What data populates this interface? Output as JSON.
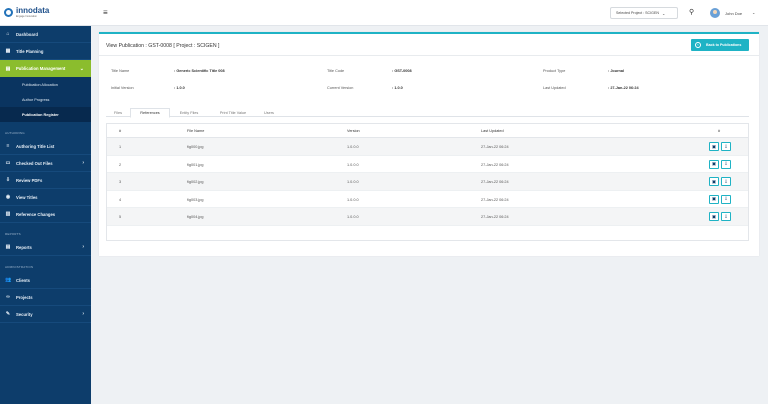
{
  "app": {
    "logo_name": "innodata",
    "logo_tagline": "Engage Innovation"
  },
  "sidebar": {
    "dashboard": "Dashboard",
    "title_planning": "Title Planning",
    "publication_management": "Publication Management",
    "sub_items": [
      "Publication Allocation",
      "Author Progress",
      "Publication Register"
    ],
    "section_authoring": "AUTHORING",
    "authoring_items": [
      "Authoring Title List",
      "Checked Out Files",
      "Review PDFs",
      "View Titles",
      "Reference Changes"
    ],
    "section_reports": "REPORTS",
    "reports": "Reports",
    "section_admin": "ADMINISTRATION",
    "admin_items": [
      "Clients",
      "Projects",
      "Security"
    ]
  },
  "topbar": {
    "project_selector": "Selected Project : SCIGEN",
    "user_name": "John Doe"
  },
  "page": {
    "title": "View Publication : GST-0008 [ Project : SCIGEN ]",
    "back_button": "Back to Publications",
    "meta": {
      "title_name_label": "Title Name",
      "title_name_value": ": Generic Scientific Title 008",
      "title_code_label": "Title Code",
      "title_code_value": ": GST-0008",
      "product_type_label": "Product Type",
      "product_type_value": ": Journal",
      "initial_version_label": "Initial Version",
      "initial_version_value": ": 1.0.0",
      "current_version_label": "Current Version",
      "current_version_value": ": 1.0.0",
      "last_updated_label": "Last Updated",
      "last_updated_value": ": 27-Jan-22 06:24"
    },
    "tabs": [
      "Files",
      "References",
      "Entity Files",
      "Print Title Value",
      "Users"
    ],
    "table": {
      "headers": [
        "#",
        "File Name",
        "Version",
        "Last Updated",
        "#"
      ],
      "rows": [
        {
          "num": "1",
          "file": "fig000.jpg",
          "version": "1.0.0.0",
          "updated": "27-Jan-22 06:24"
        },
        {
          "num": "2",
          "file": "fig001.jpg",
          "version": "1.0.0.0",
          "updated": "27-Jan-22 06:24"
        },
        {
          "num": "3",
          "file": "fig002.jpg",
          "version": "1.0.0.0",
          "updated": "27-Jan-22 06:24"
        },
        {
          "num": "4",
          "file": "fig003.jpg",
          "version": "1.0.0.0",
          "updated": "27-Jan-22 06:24"
        },
        {
          "num": "5",
          "file": "fig004.jpg",
          "version": "1.0.0.0",
          "updated": "27-Jan-22 06:24"
        }
      ]
    }
  },
  "colors": {
    "sidebar_bg": "#0d3d6b",
    "active_green": "#8bbd2d",
    "accent_teal": "#1fb3c5"
  },
  "icons": [
    "home-icon",
    "calendar-icon",
    "folder-icon",
    "file-icon",
    "download-icon",
    "eye-icon",
    "book-icon",
    "chart-icon",
    "users-icon",
    "link-icon",
    "wrench-icon",
    "search-icon",
    "back-icon",
    "view-icon"
  ]
}
